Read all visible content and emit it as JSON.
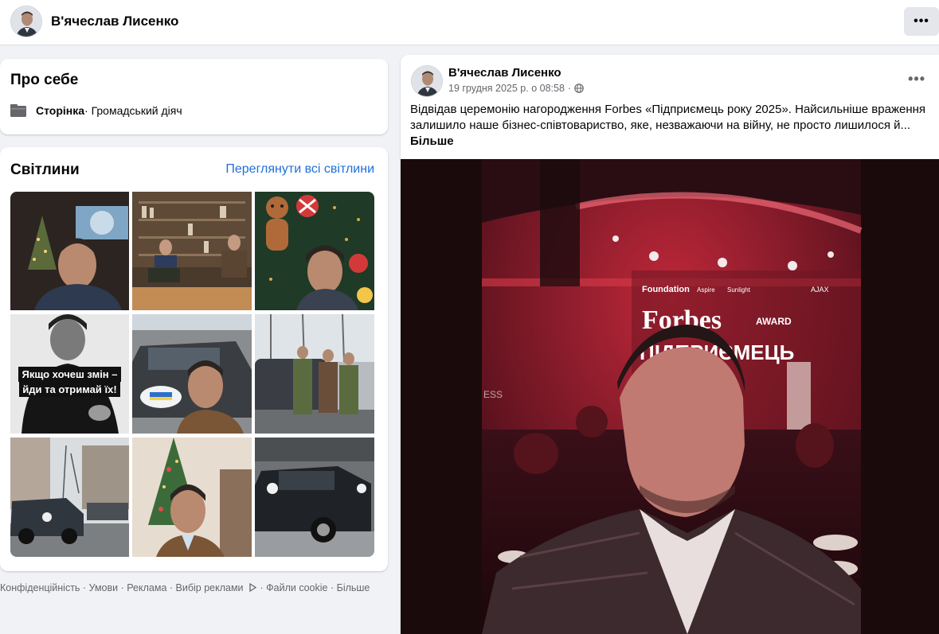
{
  "header": {
    "profile_name": "В'ячеслав Лисенко",
    "more_icon": "more-horizontal-icon"
  },
  "about": {
    "title": "Про себе",
    "category_label": "Сторінка",
    "category_value": " · Громадський діяч",
    "category_icon": "flag-page-icon"
  },
  "photos": {
    "title": "Світлини",
    "see_all": "Переглянути всі світлини",
    "overlay_text_line1": "Якщо хочеш змін –",
    "overlay_text_line2": "йди та отримай їх!"
  },
  "footer": {
    "links": [
      "Конфіденційність",
      "Умови",
      "Реклама",
      "Вибір реклами",
      "Файли cookie",
      "Більше"
    ],
    "separator": " · ",
    "adchoices_icon": "adchoices-icon"
  },
  "post": {
    "author": "В'ячеслав Лисенко",
    "timestamp": "19 грудня 2025 р. о 08:58",
    "separator": "·",
    "audience_icon": "globe-icon",
    "text": "Відвідав церемонію нагородження Forbes «Підприємець року 2025». Найсильніше враження залишило наше бізнес-співтовариство, яке, незважаючи на війну, не просто лишилося й...",
    "see_more": "Більше",
    "image_text": {
      "brand": "Forbes",
      "award": "AWARD",
      "headline": "ПІДПРИЄМЕЦЬ",
      "sponsor": "Foundation",
      "side": "ESS",
      "partners": [
        "Aspire",
        "Sunlight",
        "AJAX"
      ]
    }
  },
  "colors": {
    "link": "#216fdb",
    "secondary_text": "#65676b",
    "page_bg": "#f0f2f5"
  }
}
